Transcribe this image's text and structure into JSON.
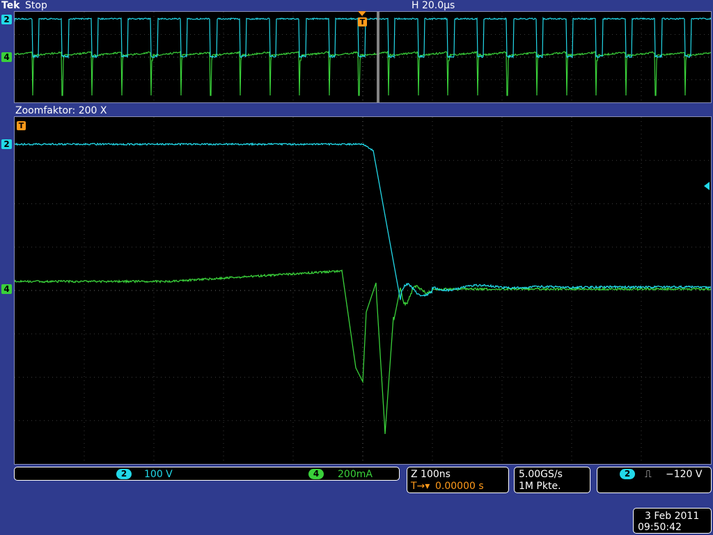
{
  "header": {
    "brand": "Tek",
    "acquisition_state": "Stop",
    "horizontal_scale": "H 20.0µs",
    "zoom_label": "Zoomfaktor: 200 X"
  },
  "markers": {
    "ch2": "2",
    "ch4": "4",
    "trigger": "T"
  },
  "channels": [
    {
      "id": "2",
      "scale": "100 V",
      "color": "#22d8e8"
    },
    {
      "id": "4",
      "scale": "200mA",
      "color": "#3ad13a"
    }
  ],
  "timebase": {
    "zoom_scale": "Z 100ns",
    "trigger_position_prefix": "T→▾",
    "trigger_position": "0.00000 s"
  },
  "acquisition": {
    "sample_rate": "5.00GS/s",
    "record_length": "1M Pkte."
  },
  "trigger": {
    "source": "2",
    "slope_symbol": "⎍",
    "level": "−120 V"
  },
  "timestamp": {
    "date": "3 Feb 2011",
    "time": "09:50:42"
  },
  "colors": {
    "ch2": "#22d8e8",
    "ch4": "#3ad13a",
    "trigger": "#ff9a1a",
    "background": "#2f3b8e"
  }
}
